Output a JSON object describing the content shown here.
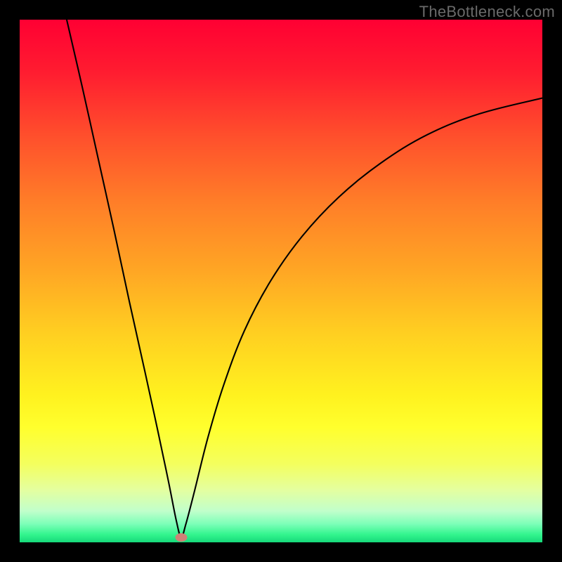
{
  "watermark": "TheBottleneck.com",
  "chart_data": {
    "type": "line",
    "title": "",
    "xlabel": "",
    "ylabel": "",
    "xlim": [
      0,
      100
    ],
    "ylim": [
      0,
      100
    ],
    "marker": {
      "x": 30.9,
      "y": 1.0,
      "color": "#cf8277"
    },
    "gradient_stops": [
      {
        "offset": 0.0,
        "color": "#ff0033"
      },
      {
        "offset": 0.1,
        "color": "#ff1c30"
      },
      {
        "offset": 0.22,
        "color": "#ff4e2c"
      },
      {
        "offset": 0.35,
        "color": "#ff7e28"
      },
      {
        "offset": 0.48,
        "color": "#ffa624"
      },
      {
        "offset": 0.6,
        "color": "#ffcf21"
      },
      {
        "offset": 0.72,
        "color": "#fff21f"
      },
      {
        "offset": 0.78,
        "color": "#ffff2d"
      },
      {
        "offset": 0.85,
        "color": "#f4ff5e"
      },
      {
        "offset": 0.9,
        "color": "#e4ffa0"
      },
      {
        "offset": 0.94,
        "color": "#c1ffcb"
      },
      {
        "offset": 0.965,
        "color": "#7cffb8"
      },
      {
        "offset": 0.985,
        "color": "#33f58e"
      },
      {
        "offset": 1.0,
        "color": "#16d97a"
      }
    ],
    "curve": {
      "description": "V-shaped bottleneck curve. Left branch descends nearly straight from top-left to the minimum. Right branch rises with decreasing slope toward the right edge.",
      "x_left_top": 9.0,
      "x_min": 30.9,
      "y_at_right_edge": 85,
      "points": [
        {
          "x": 9.0,
          "y": 100.0
        },
        {
          "x": 12.0,
          "y": 87.0
        },
        {
          "x": 15.0,
          "y": 73.5
        },
        {
          "x": 18.0,
          "y": 60.0
        },
        {
          "x": 21.0,
          "y": 46.0
        },
        {
          "x": 24.0,
          "y": 32.5
        },
        {
          "x": 26.5,
          "y": 21.0
        },
        {
          "x": 28.5,
          "y": 11.5
        },
        {
          "x": 30.0,
          "y": 4.0
        },
        {
          "x": 30.9,
          "y": 1.0
        },
        {
          "x": 31.8,
          "y": 3.5
        },
        {
          "x": 33.5,
          "y": 10.0
        },
        {
          "x": 36.0,
          "y": 20.0
        },
        {
          "x": 39.0,
          "y": 30.0
        },
        {
          "x": 43.0,
          "y": 40.5
        },
        {
          "x": 48.0,
          "y": 50.0
        },
        {
          "x": 54.0,
          "y": 58.5
        },
        {
          "x": 61.0,
          "y": 66.0
        },
        {
          "x": 69.0,
          "y": 72.5
        },
        {
          "x": 78.0,
          "y": 78.0
        },
        {
          "x": 88.0,
          "y": 82.0
        },
        {
          "x": 100.0,
          "y": 85.0
        }
      ]
    }
  }
}
